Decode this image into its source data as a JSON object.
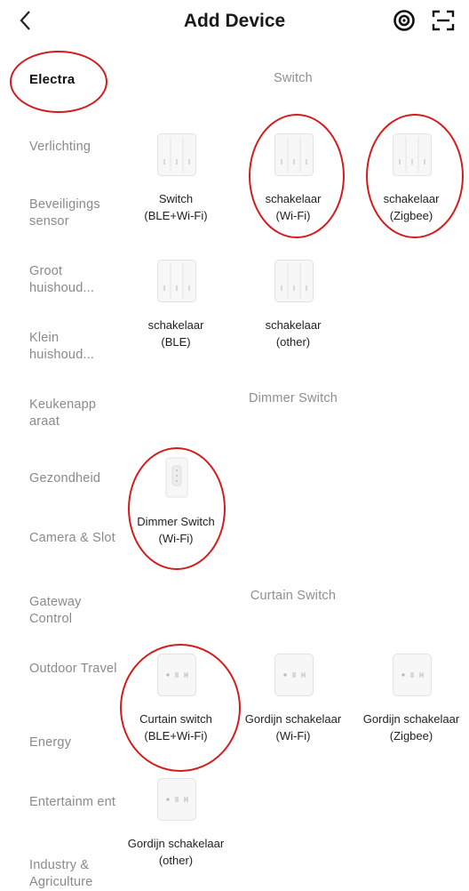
{
  "header": {
    "title": "Add Device"
  },
  "sidebar": {
    "items": [
      {
        "label": "Electra"
      },
      {
        "label": "Verlichting"
      },
      {
        "label": "Beveiligings sensor"
      },
      {
        "label": "Groot huishoud..."
      },
      {
        "label": "Klein huishoud..."
      },
      {
        "label": "Keukenapp araat"
      },
      {
        "label": "Gezondheid"
      },
      {
        "label": "Camera & Slot"
      },
      {
        "label": "Gateway Control"
      },
      {
        "label": "Outdoor Travel"
      },
      {
        "label": "Energy"
      },
      {
        "label": "Entertainm ent"
      },
      {
        "label": "Industry & Agriculture"
      }
    ]
  },
  "sections": [
    {
      "title": "Switch",
      "devices": [
        {
          "name": "Switch",
          "sub": "(BLE+Wi-Fi)",
          "icon": "switch-panel-icon"
        },
        {
          "name": "schakelaar",
          "sub": "(Wi-Fi)",
          "icon": "switch-panel-icon"
        },
        {
          "name": "schakelaar",
          "sub": "(Zigbee)",
          "icon": "switch-panel-icon"
        },
        {
          "name": "schakelaar",
          "sub": "(BLE)",
          "icon": "switch-panel-icon"
        },
        {
          "name": "schakelaar",
          "sub": "(other)",
          "icon": "switch-panel-icon"
        }
      ]
    },
    {
      "title": "Dimmer Switch",
      "devices": [
        {
          "name": "Dimmer Switch",
          "sub": "(Wi-Fi)",
          "icon": "dimmer-switch-icon"
        }
      ]
    },
    {
      "title": "Curtain Switch",
      "devices": [
        {
          "name": "Curtain switch",
          "sub": "(BLE+Wi-Fi)",
          "icon": "curtain-switch-icon"
        },
        {
          "name": "Gordijn schakelaar",
          "sub": "(Wi-Fi)",
          "icon": "curtain-switch-icon"
        },
        {
          "name": "Gordijn schakelaar",
          "sub": "(Zigbee)",
          "icon": "curtain-switch-icon"
        },
        {
          "name": "Gordijn schakelaar",
          "sub": "(other)",
          "icon": "curtain-switch-icon"
        }
      ]
    }
  ],
  "colors": {
    "annotation": "#d41c1c",
    "muted_text": "#8a8a8a"
  }
}
